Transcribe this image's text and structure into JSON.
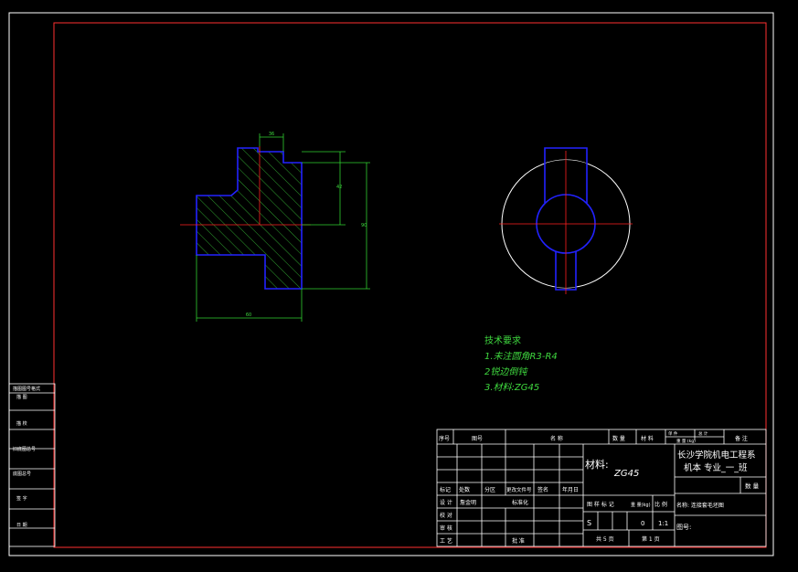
{
  "drawing": {
    "dimensions": {
      "top_width": "36",
      "right_height_inner": "42",
      "right_height_outer": "90",
      "bottom_width": "60"
    },
    "notes": {
      "title": "技术要求",
      "item1": "1.未注圆角R3-R4",
      "item2": "2锐边倒钝",
      "item3": "3.材料:ZG45"
    }
  },
  "side_stamp": {
    "rows": [
      "描图图号格式",
      "描  图",
      "描  校",
      "旧底图总号",
      "底图总号",
      "签  字",
      "日  期"
    ]
  },
  "title_block": {
    "header": {
      "seq": "序号",
      "drawing_no": "图号",
      "name": "名   称",
      "qty": "数 量",
      "material": "材  料",
      "unit_weight": "单 件",
      "total_weight": "总 计",
      "weight_unit": "重 量 (kg)",
      "remark": "备 注"
    },
    "material_label": "材料:",
    "material_value": "ZG45",
    "school_line1": "长沙学院机电工程系",
    "school_line2": "机本 专业_一_班",
    "quantity_label": "数 量",
    "part_name": "名称: 连接套毛坯图",
    "drawing_no_label": "图号:",
    "change_row": {
      "mark": "标记",
      "count": "处数",
      "zone": "分区",
      "doc": "更改文件号",
      "sign": "签名",
      "date": "年月日"
    },
    "roles": {
      "design": "设 计",
      "designer": "詹金明",
      "standard": "标准化",
      "proof": "校 对",
      "review": "审 核",
      "process": "工 艺",
      "approve": "批 准"
    },
    "stage": {
      "stage_mark": "图 样 标 记",
      "weight": "重 量(kg)",
      "scale": "比 例",
      "mark_value": "S",
      "weight_value": "0",
      "scale_value": "1:1",
      "total_sheets": "共 5 页",
      "sheet": "第 1 页"
    }
  },
  "colors": {
    "frame": "#ff3030",
    "outline": "#2222ff",
    "hatch": "#30b030",
    "dimension": "#30d030",
    "centerline": "#ff2020",
    "text": "#ffffff"
  }
}
